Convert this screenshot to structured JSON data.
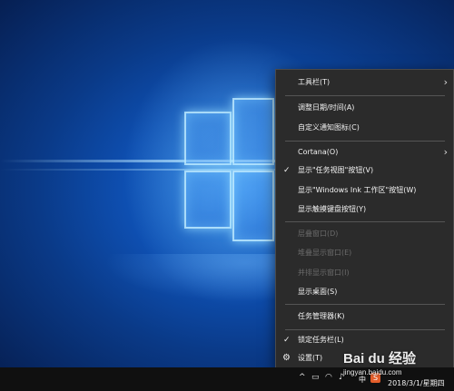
{
  "menu": {
    "items": [
      {
        "label": "工具栏(T)",
        "has_submenu": true
      },
      {
        "label": "调整日期/时间(A)"
      },
      {
        "label": "自定义通知图标(C)"
      },
      {
        "label": "Cortana(O)",
        "has_submenu": true
      },
      {
        "label": "显示\"任务视图\"按钮(V)",
        "checked": true
      },
      {
        "label": "显示\"Windows Ink 工作区\"按钮(W)"
      },
      {
        "label": "显示触摸键盘按钮(Y)"
      },
      {
        "label": "层叠窗口(D)",
        "disabled": true
      },
      {
        "label": "堆叠显示窗口(E)",
        "disabled": true
      },
      {
        "label": "并排显示窗口(I)",
        "disabled": true
      },
      {
        "label": "显示桌面(S)"
      },
      {
        "label": "任务管理器(K)"
      },
      {
        "label": "锁定任务栏(L)",
        "checked": true
      },
      {
        "label": "设置(T)",
        "icon": "gear-icon"
      }
    ],
    "check_glyph": "✓",
    "chevron_glyph": "›",
    "gear_glyph": "⚙"
  },
  "taskbar": {
    "lang": "中",
    "ime": "S",
    "date": "2018/3/1/星期四"
  },
  "watermark": {
    "brand": "Bai du 经验",
    "url": "jingyan.baidu.com"
  },
  "colors": {
    "menu_bg": "#2b2b2b",
    "taskbar_bg": "#101010",
    "wallpaper_blue": "#0e4fb1"
  }
}
